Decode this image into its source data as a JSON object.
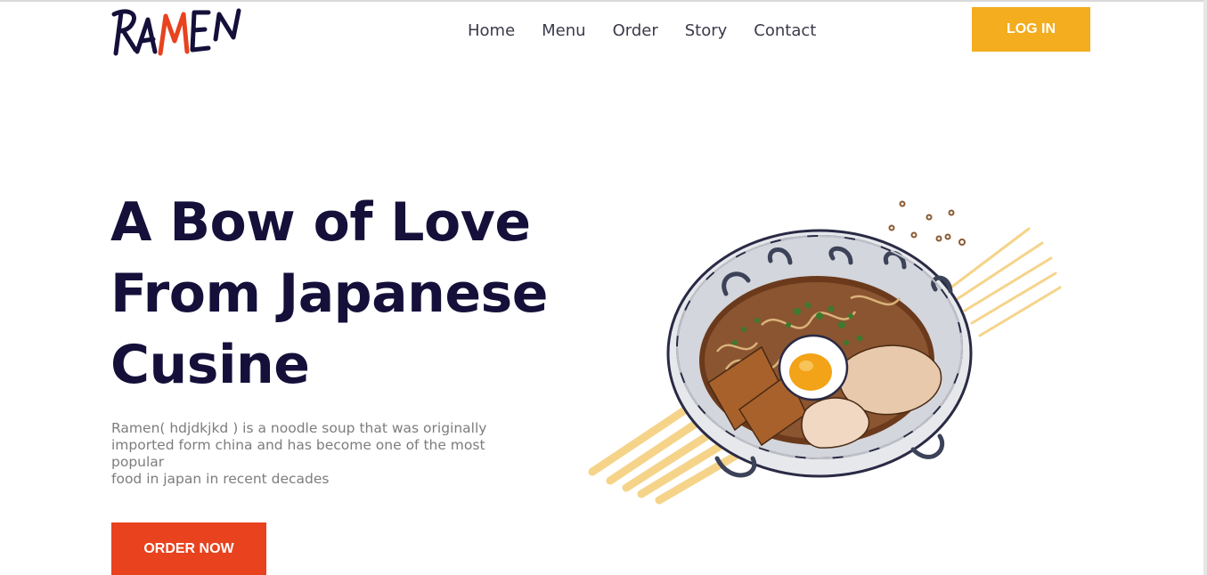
{
  "brand": {
    "logo_text": "RAMEN",
    "accent_color": "#e8421e",
    "ink_color": "#14103a"
  },
  "nav": {
    "items": [
      {
        "label": "Home"
      },
      {
        "label": "Menu"
      },
      {
        "label": "Order"
      },
      {
        "label": "Story"
      },
      {
        "label": "Contact"
      }
    ]
  },
  "header": {
    "login_label": "LOG IN",
    "login_color": "#f3ad1e"
  },
  "hero": {
    "title_lines": [
      "A Bow of Love",
      "From Japanese",
      "Cusine"
    ],
    "description_lines": [
      "Ramen( hdjdkjkd ) is a noodle soup that was originally",
      "imported form china and has become one of the most",
      "popular",
      "food in japan in recent decades"
    ],
    "cta_label": "ORDER NOW",
    "image": "ramen-bowl-illustration"
  }
}
